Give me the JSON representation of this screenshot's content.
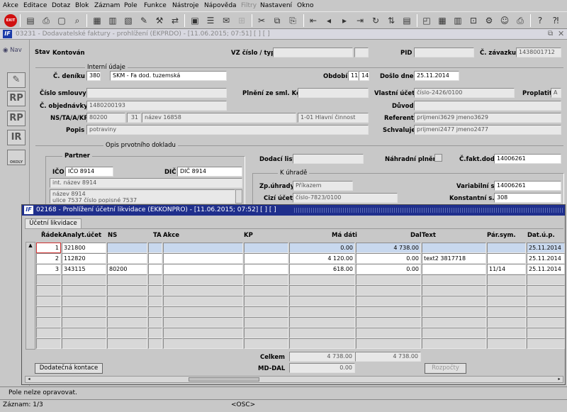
{
  "menu": [
    "Akce",
    "Editace",
    "Dotaz",
    "Blok",
    "Záznam",
    "Pole",
    "Funkce",
    "Nástroje",
    "Nápověda",
    "Filtry",
    "Nastavení",
    "Okno"
  ],
  "toolbar": {
    "exit_label": "EXIT"
  },
  "window1": {
    "title": "03231 - Dodavatelské faktury - prohlížení (EKPRDO) - [11.06.2015; 07:51] [ ] [ ]",
    "nav_label": "Nav",
    "side_buttons": [
      "RP",
      "RP",
      "IR",
      "OKOLY"
    ],
    "stav_label": "Stav",
    "stav_value": "Kontován",
    "vz_label": "VZ číslo / typ",
    "vz_value": "",
    "vz_type": "",
    "pid_label": "PID",
    "pid_value": "",
    "zavazku_label": "Č. závazku",
    "zavazku_value": "1438001712",
    "interni_group": "Interní údaje",
    "denik_label": "Č. deníku",
    "denik_value": "380",
    "denik_name": "SKM - Fa dod. tuzemská",
    "obdobi_label": "Období",
    "obdobi_1": "11",
    "obdobi_2": "14",
    "doslo_label": "Došlo dne",
    "doslo_value": "25.11.2014",
    "smlouvy_label": "Číslo smlouvy",
    "smlouvy_value": "",
    "plneni_label": "Plnění ze sml. Kč",
    "plneni_value": "",
    "vlastni_label": "Vlastní účet",
    "vlastni_value": "číslo-2426/0100",
    "proplatit_label": "Proplatit",
    "proplatit_value": "A",
    "objednavky_label": "Č. objednávky",
    "objednavky_value": "1480200193",
    "duvod_label": "Důvod",
    "duvod_value": "",
    "ns_label": "NS/TA/A/KP",
    "ns_value": "80200",
    "ta_value": "31",
    "a_value": "název 16858",
    "kp_value": "1-01 Hlavní činnost",
    "referent_label": "Referent",
    "referent_value": "prijmeni3629 jmeno3629",
    "popis_label": "Popis",
    "popis_value": "potraviny",
    "schvaluje_label": "Schvaluje",
    "schvaluje_value": "prijmeni2477 jmeno2477",
    "opis_group": "Opis prvotního dokladu",
    "partner_group": "Partner",
    "ico_label": "IČO",
    "ico_value": "IČO 8914",
    "dic_label": "DIČ",
    "dic_value": "DIČ 8914",
    "partner_name": "int. název 8914",
    "partner_addr1": "název 8914",
    "partner_addr2": "ulice 7537 číslo popisné 7537",
    "dodaci_label": "Dodací list",
    "dodaci_value": "",
    "nahradni_label": "Náhradní plnění",
    "cfakt_label": "Č.fakt.dod.",
    "cfakt_value": "14006261",
    "uhrade_group": "K úhradě",
    "zpuhr_label": "Zp.úhrady",
    "zpuhr_value": "Příkazem",
    "variab_label": "Variabilní s.",
    "variab_value": "14006261",
    "cizi_label": "Cizí účet",
    "cizi_value": "číslo-7823/0100",
    "konst_label": "Konstantní s.",
    "konst_value": "308"
  },
  "window2": {
    "title": "02168 - Prohlížení účetní likvidace (EKKONPRO) - [11.06.2015; 07:52] [ ] [ ]",
    "tab_label": "Účetní likvidace",
    "columns": {
      "radek": "Řádek",
      "analyt": "Analyt.účet",
      "ns": "NS",
      "ta": "TA",
      "akce": "Akce",
      "kp": "KP",
      "madati": "Má dáti",
      "dal": "Dal",
      "text": "Text",
      "parsym": "Pár.sym.",
      "datup": "Dat.ú.p."
    },
    "rows": [
      {
        "radek": "1",
        "analyt": "321800",
        "ns": "",
        "ta": "",
        "akce": "",
        "kp": "",
        "madati": "0.00",
        "dal": "4 738.00",
        "text": "",
        "parsym": "",
        "datup": "25.11.2014"
      },
      {
        "radek": "2",
        "analyt": "112820",
        "ns": "",
        "ta": "",
        "akce": "",
        "kp": "",
        "madati": "4 120.00",
        "dal": "0.00",
        "text": "text2 3817718",
        "parsym": "",
        "datup": "25.11.2014"
      },
      {
        "radek": "3",
        "analyt": "343115",
        "ns": "80200",
        "ta": "",
        "akce": "",
        "kp": "",
        "madati": "618.00",
        "dal": "0.00",
        "text": "",
        "parsym": "11/14",
        "datup": "25.11.2014"
      }
    ],
    "celkem_label": "Celkem",
    "celkem_madati": "4 738.00",
    "celkem_dal": "4 738.00",
    "mddal_label": "MD-DAL",
    "mddal_value": "0.00",
    "dodatecna_button": "Dodatečná kontace",
    "rozpocty_button": "Rozpočty"
  },
  "status": {
    "message": "Pole nelze opravovat.",
    "record": "Záznam: 1/3",
    "osc": "<OSC>"
  }
}
